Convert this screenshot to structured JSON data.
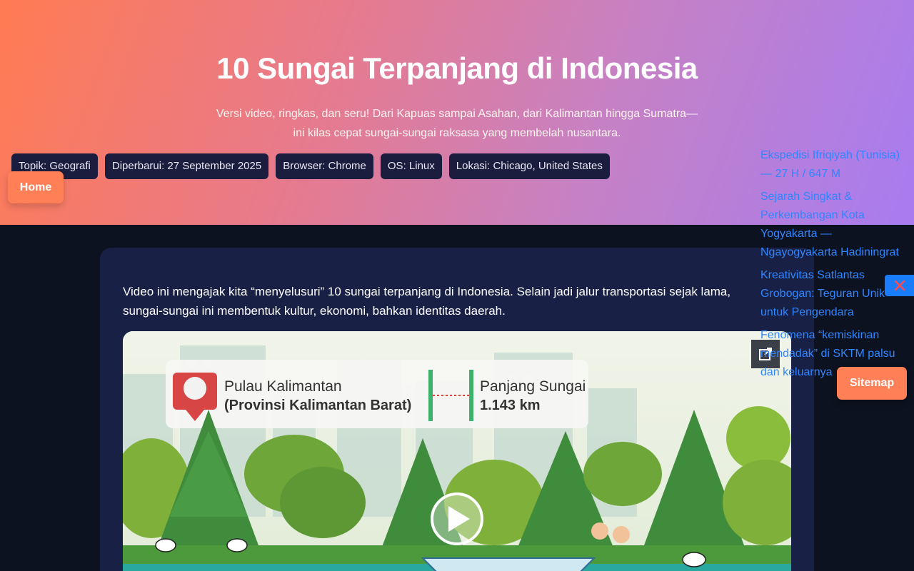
{
  "hero": {
    "title": "10 Sungai Terpanjang di Indonesia",
    "subtitle_line1": "Versi video, ringkas, dan seru! Dari Kapuas sampai Asahan, dari Kalimantan hingga Sumatra—",
    "subtitle_line2": "ini kilas cepat sungai-sungai raksasa yang membelah nusantara."
  },
  "chips": [
    {
      "label": "Topik: Geografi"
    },
    {
      "label": "Diperbarui: 27 September 2025"
    },
    {
      "label": "Browser: Chrome"
    },
    {
      "label": "OS: Linux"
    },
    {
      "label": "Lokasi: Chicago, United States"
    }
  ],
  "nav": {
    "home_label": "Home",
    "sitemap_label": "Sitemap"
  },
  "article": {
    "intro": "Video ini mengajak kita “menyelusuri” 10 sungai terpanjang di Indonesia. Selain jadi jalur transportasi sejak lama, sungai-sungai ini membentuk kultur, ekonomi, bahkan identitas daerah."
  },
  "video": {
    "island_line1": "Pulau Kalimantan",
    "island_line2": "(Provinsi Kalimantan Barat)",
    "length_label": "Panjang Sungai",
    "length_value": "1.143 km",
    "play_icon": "play-icon",
    "open_icon": "external-link-icon"
  },
  "sidebar": {
    "links": [
      {
        "label": "Ekspedisi Ifriqiyah (Tunisia) — 27 H / 647 M"
      },
      {
        "label": "Sejarah Singkat & Perkembangan Kota Yogyakarta — Ngayogyakarta Hadiningrat"
      },
      {
        "label": "Kreativitas Satlantas Grobogan: Teguran Unik untuk Pengendara"
      },
      {
        "label": "Fenomena “kemiskinan mendadak” di SKTM palsu dan keluarnya"
      }
    ],
    "close_icon": "close-icon"
  },
  "colors": {
    "accent": "#ff7f56",
    "link": "#2f86ff",
    "chip_bg": "#1b1d3e",
    "card_bg": "#182045"
  }
}
